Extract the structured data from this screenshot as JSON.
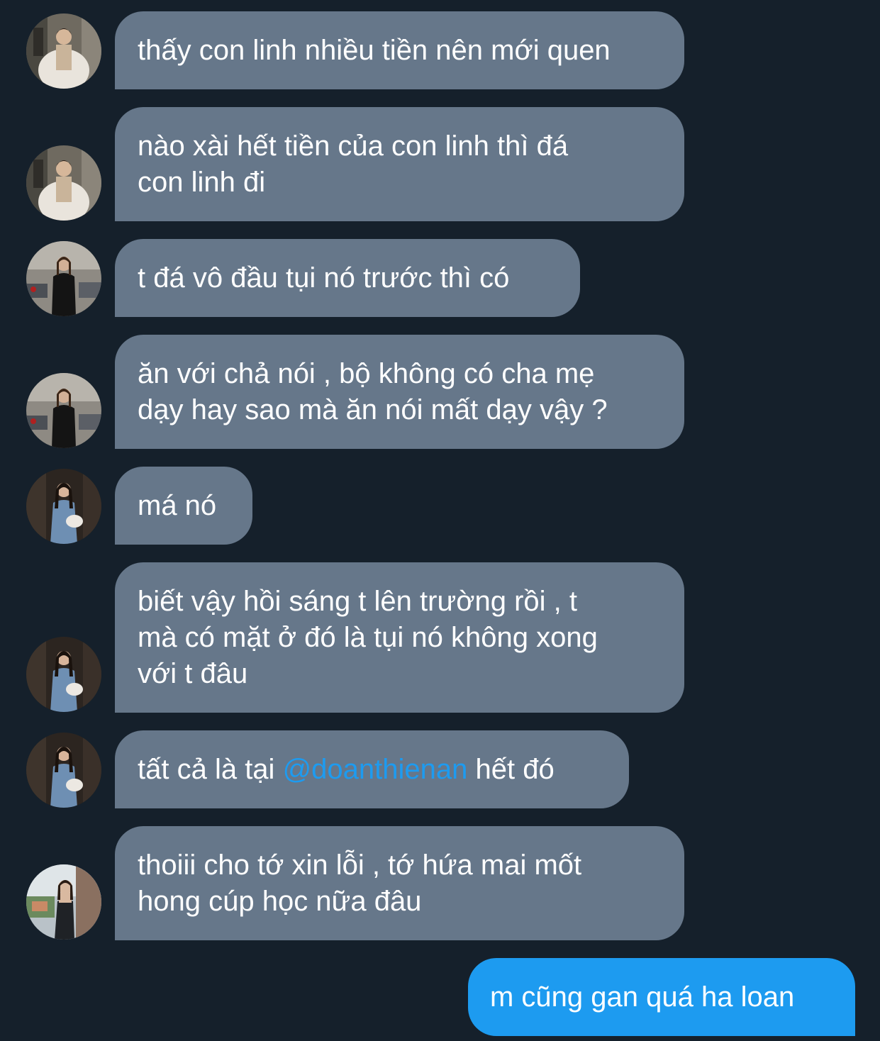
{
  "conversation": {
    "messages": [
      {
        "avatar": "avatar-fur-coat",
        "lines": [
          "thấy con linh nhiều tiền nên mới quen"
        ]
      },
      {
        "avatar": "avatar-fur-coat",
        "lines": [
          "nào xài hết tiền của con linh thì đá",
          "con linh đi"
        ]
      },
      {
        "avatar": "avatar-black-outfit",
        "lines": [
          "t đá vô đầu tụi nó trước thì có"
        ]
      },
      {
        "avatar": "avatar-black-outfit",
        "lines": [
          "ăn với chả nói , bộ không có cha mẹ",
          "dạy hay sao mà ăn nói mất dạy vậy ?"
        ]
      },
      {
        "avatar": "avatar-denim-outfit",
        "lines": [
          "má nó"
        ]
      },
      {
        "avatar": "avatar-denim-outfit",
        "lines": [
          "biết vậy hồi sáng t lên trường rồi , t",
          "mà có mặt ở đó là tụi nó không xong",
          "với t đâu"
        ]
      },
      {
        "avatar": "avatar-denim-outfit",
        "before": "tất cả là tại ",
        "mention": "@doanthienan",
        "after": " hết đó"
      },
      {
        "avatar": "avatar-outdoor-photo",
        "lines": [
          "thoiii cho tớ xin lỗi , tớ hứa mai mốt",
          "hong cúp học nữa đâu"
        ]
      }
    ],
    "outgoing": {
      "text": "m cũng gan quá ha loan"
    }
  },
  "colors": {
    "background": "#15202b",
    "incoming_bubble": "#66778a",
    "outgoing_bubble": "#1d9bf0",
    "mention": "#1d9bf0",
    "text": "#ffffff"
  }
}
